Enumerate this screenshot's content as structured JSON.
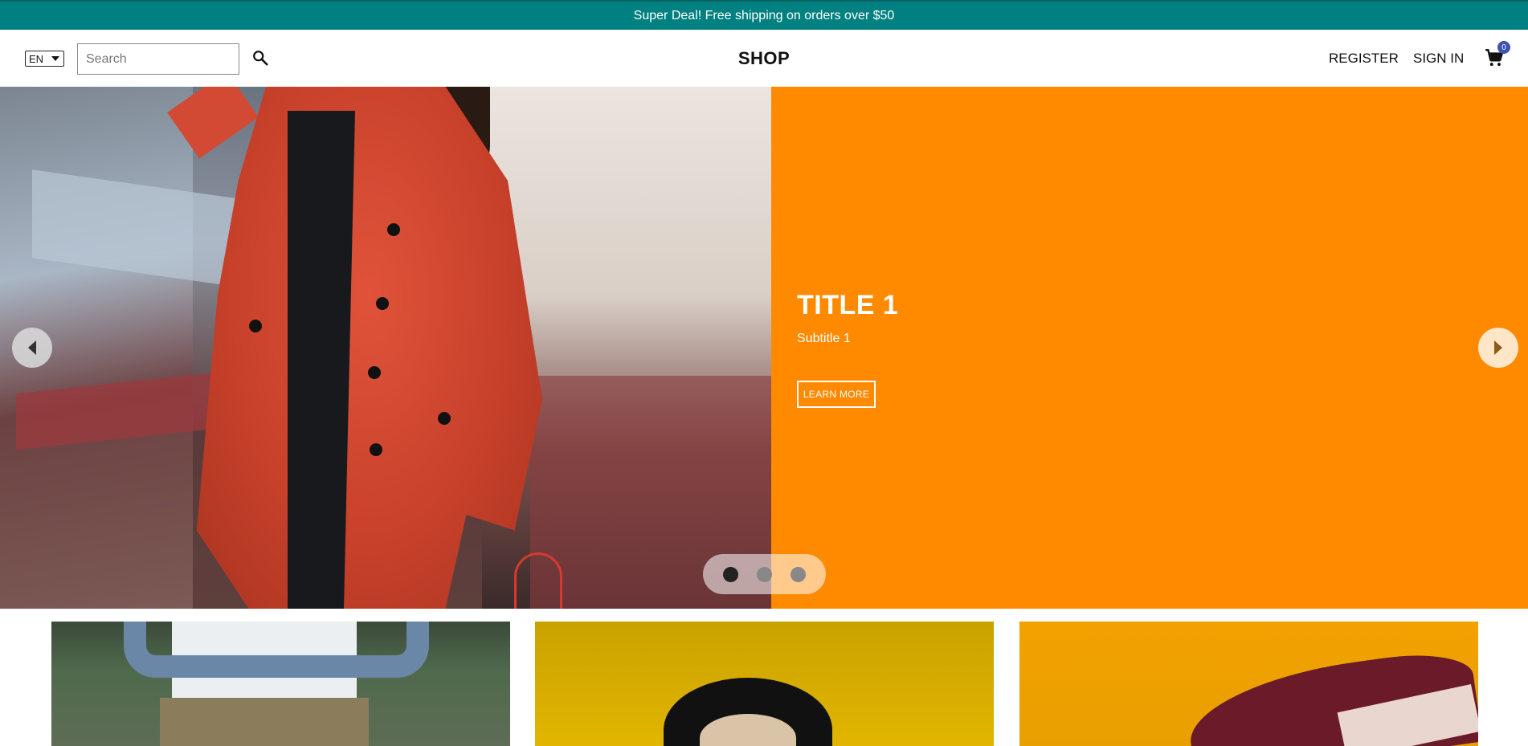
{
  "announcement": {
    "text": "Super Deal! Free shipping on orders over $50"
  },
  "navbar": {
    "language": "EN",
    "search_placeholder": "Search",
    "logo": "SHOP",
    "register": "REGISTER",
    "sign_in": "SIGN IN",
    "cart_count": "0",
    "icons": {
      "search": "search-icon",
      "cart": "shopping-cart-icon"
    }
  },
  "hero": {
    "title": "TITLE 1",
    "subtitle": "Subtitle 1",
    "button": "LEARN MORE",
    "panel_color": "#ff8a00",
    "active_slide": 1,
    "slide_count": 3
  },
  "colors": {
    "announcement_bg": "#008080",
    "badge": "#3f51b5"
  }
}
